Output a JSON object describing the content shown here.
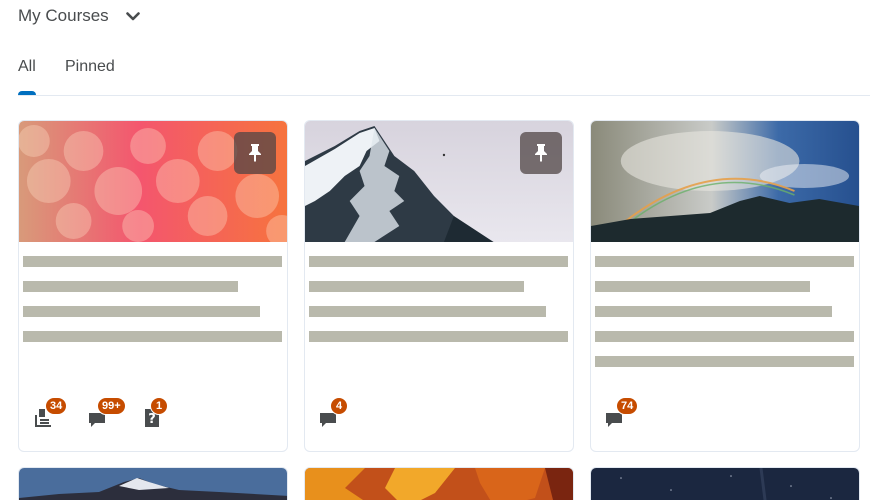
{
  "header": {
    "title": "My Courses",
    "chevron_icon": "chevron-down-icon"
  },
  "tabs": [
    {
      "label": "All",
      "selected": true
    },
    {
      "label": "Pinned",
      "selected": false
    }
  ],
  "colors": {
    "accent": "#006fbf",
    "badge": "#c64c00",
    "skeleton": "#b9b9ac",
    "pin_bg": "#504646"
  },
  "cards": [
    {
      "image": "pink-bokeh",
      "pinned": true,
      "notifications": [
        {
          "icon": "assignments-icon",
          "count": "34"
        },
        {
          "icon": "discussions-icon",
          "count": "99+"
        },
        {
          "icon": "quizzes-icon",
          "count": "1"
        }
      ]
    },
    {
      "image": "snowy-mountain",
      "pinned": true,
      "notifications": [
        {
          "icon": "discussions-icon",
          "count": "4"
        }
      ]
    },
    {
      "image": "rainbow-sky",
      "pinned": false,
      "notifications": [
        {
          "icon": "discussions-icon",
          "count": "74"
        }
      ]
    }
  ],
  "more_cards": [
    {
      "image": "mountain-lake"
    },
    {
      "image": "autumn-leaves"
    },
    {
      "image": "night-sky"
    }
  ]
}
